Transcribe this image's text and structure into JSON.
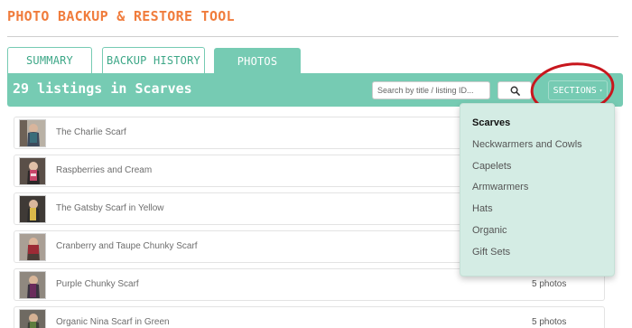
{
  "app": {
    "title": "PHOTO BACKUP & RESTORE TOOL"
  },
  "tabs": [
    {
      "label": "SUMMARY",
      "active": false
    },
    {
      "label": "BACKUP HISTORY",
      "active": false
    },
    {
      "label": "PHOTOS",
      "active": true
    }
  ],
  "toolbar": {
    "heading": "29 listings in Scarves",
    "search_placeholder": "Search by title / listing ID...",
    "search_icon": "search-icon",
    "sections_label": "SECTIONS",
    "sections_caret": "▾"
  },
  "colors": {
    "accent": "#76cbb3",
    "title_orange": "#f07c3c",
    "highlight_red": "#c8161d",
    "dropdown_bg": "#d4ece4"
  },
  "listings": [
    {
      "title": "The Charlie Scarf",
      "photos": ""
    },
    {
      "title": "Raspberries and Cream",
      "photos": ""
    },
    {
      "title": "The Gatsby Scarf in Yellow",
      "photos": ""
    },
    {
      "title": "Cranberry and Taupe Chunky Scarf",
      "photos": ""
    },
    {
      "title": "Purple Chunky Scarf",
      "photos": "5 photos"
    },
    {
      "title": "Organic Nina Scarf in Green",
      "photos": "5 photos"
    }
  ],
  "sections_menu": {
    "selected": "Scarves",
    "items": [
      "Scarves",
      "Neckwarmers and Cowls",
      "Capelets",
      "Armwarmers",
      "Hats",
      "Organic",
      "Gift Sets"
    ]
  }
}
